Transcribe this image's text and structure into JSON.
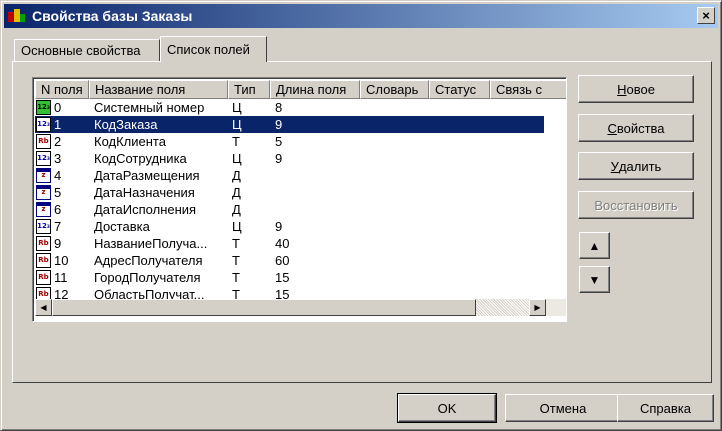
{
  "window": {
    "title": "Свойства базы Заказы",
    "close_label": "×"
  },
  "tabs": [
    {
      "label": "Основные свойства",
      "active": false
    },
    {
      "label": "Список полей",
      "active": true
    }
  ],
  "field_list": {
    "columns": [
      "N поля",
      "Название поля",
      "Тип",
      "Длина поля",
      "Словарь",
      "Статус",
      "Связь с"
    ],
    "rows": [
      {
        "num": "0",
        "name": "Системный номер",
        "type": "Ц",
        "length": "8",
        "icon": "numeric-system-field-icon"
      },
      {
        "num": "1",
        "name": "КодЗаказа",
        "type": "Ц",
        "length": "9",
        "icon": "numeric-field-icon",
        "selected": true
      },
      {
        "num": "2",
        "name": "КодКлиента",
        "type": "Т",
        "length": "5",
        "icon": "text-field-icon"
      },
      {
        "num": "3",
        "name": "КодСотрудника",
        "type": "Ц",
        "length": "9",
        "icon": "numeric-field-icon"
      },
      {
        "num": "4",
        "name": "ДатаРазмещения",
        "type": "Д",
        "length": "",
        "icon": "date-field-icon"
      },
      {
        "num": "5",
        "name": "ДатаНазначения",
        "type": "Д",
        "length": "",
        "icon": "date-field-icon"
      },
      {
        "num": "6",
        "name": "ДатаИсполнения",
        "type": "Д",
        "length": "",
        "icon": "date-field-icon"
      },
      {
        "num": "7",
        "name": "Доставка",
        "type": "Ц",
        "length": "9",
        "icon": "numeric-field-icon"
      },
      {
        "num": "9",
        "name": "НазваниеПолуча...",
        "type": "Т",
        "length": "40",
        "icon": "text-field-icon"
      },
      {
        "num": "10",
        "name": "АдресПолучателя",
        "type": "Т",
        "length": "60",
        "icon": "text-field-icon"
      },
      {
        "num": "11",
        "name": "ГородПолучателя",
        "type": "Т",
        "length": "15",
        "icon": "text-field-icon"
      },
      {
        "num": "12",
        "name": "ОбластьПолучат...",
        "type": "Т",
        "length": "15",
        "icon": "text-field-icon"
      }
    ],
    "icon_glyphs": {
      "numeric": "12₃",
      "text": "Rb",
      "date": "z"
    }
  },
  "side_buttons": {
    "new": {
      "label": "Новое",
      "accel": "Н"
    },
    "properties": {
      "label": "Свойства",
      "accel": "С"
    },
    "delete": {
      "label": "Удалить",
      "accel": "У"
    },
    "restore": {
      "label": "Восстановить",
      "enabled": false
    },
    "move_up": "▲",
    "move_down": "▼"
  },
  "bottom_buttons": {
    "ok": "OK",
    "cancel": "Отмена",
    "help": "Справка"
  },
  "colors": {
    "selection": "#0a246a",
    "titlebar_start": "#0a246a",
    "titlebar_end": "#a6caf0",
    "face": "#d4d0c8"
  }
}
